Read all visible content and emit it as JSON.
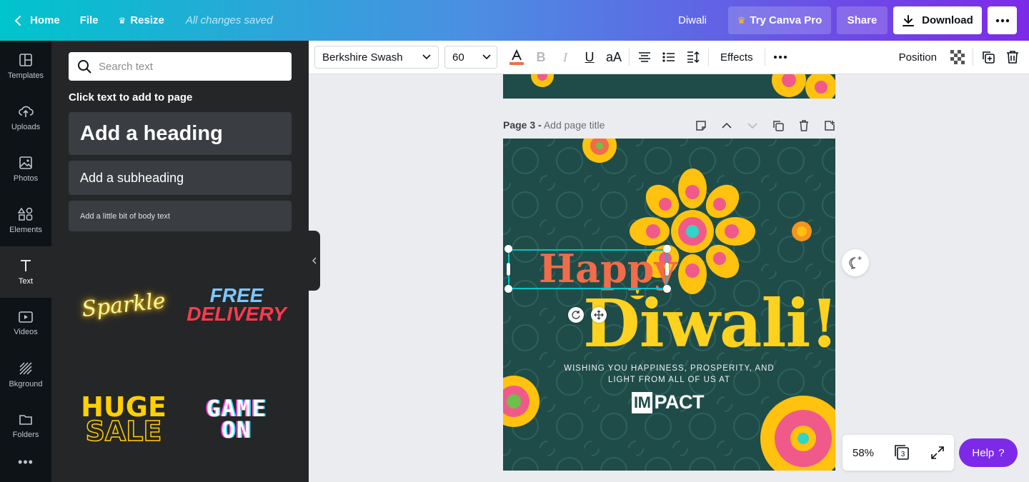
{
  "topbar": {
    "home_label": "Home",
    "file_label": "File",
    "resize_label": "Resize",
    "saved_status": "All changes saved",
    "design_title": "Diwali",
    "try_pro_label": "Try Canva Pro",
    "share_label": "Share",
    "download_label": "Download",
    "gradient_start": "#00c4cc",
    "gradient_end": "#7d2ae8"
  },
  "rail": {
    "items": [
      {
        "label": "Templates",
        "icon": "templates-icon"
      },
      {
        "label": "Uploads",
        "icon": "upload-cloud-icon"
      },
      {
        "label": "Photos",
        "icon": "image-icon"
      },
      {
        "label": "Elements",
        "icon": "shapes-icon"
      },
      {
        "label": "Text",
        "icon": "text-icon",
        "active": true
      },
      {
        "label": "Videos",
        "icon": "video-icon"
      },
      {
        "label": "Bkground",
        "icon": "background-pattern-icon"
      },
      {
        "label": "Folders",
        "icon": "folder-icon"
      }
    ]
  },
  "panel": {
    "search_placeholder": "Search text",
    "heading": "Click text to add to page",
    "add_heading": "Add a heading",
    "add_subheading": "Add a subheading",
    "add_body": "Add a little bit of body text",
    "templates": {
      "sparkle": "Sparkle",
      "free_line1": "FREE",
      "free_line2": "DELIVERY",
      "huge_line1": "HUGE",
      "huge_line2": "SALE",
      "game_line1": "GAME",
      "game_line2": "ON"
    }
  },
  "toolbar": {
    "font_family": "Berkshire Swash",
    "font_size": "60",
    "text_color": "#f26b4a",
    "effects_label": "Effects",
    "position_label": "Position"
  },
  "canvas": {
    "page_number_label": "Page 3 -",
    "page_title_placeholder": "Add page title",
    "background_color": "#1f4c48",
    "happy_text": "Happy",
    "diwali_text": "Diwali!",
    "wish_text": "WISHING YOU HAPPINESS, PROSPERITY, AND LIGHT FROM ALL OF US AT",
    "logo_box": "IM",
    "logo_rest": "PACT",
    "happy_color": "#f26b4a",
    "diwali_color": "#ffd21f"
  },
  "bottom": {
    "zoom_level": "58%",
    "page_count": "3",
    "help_label": "Help",
    "help_icon": "?"
  }
}
